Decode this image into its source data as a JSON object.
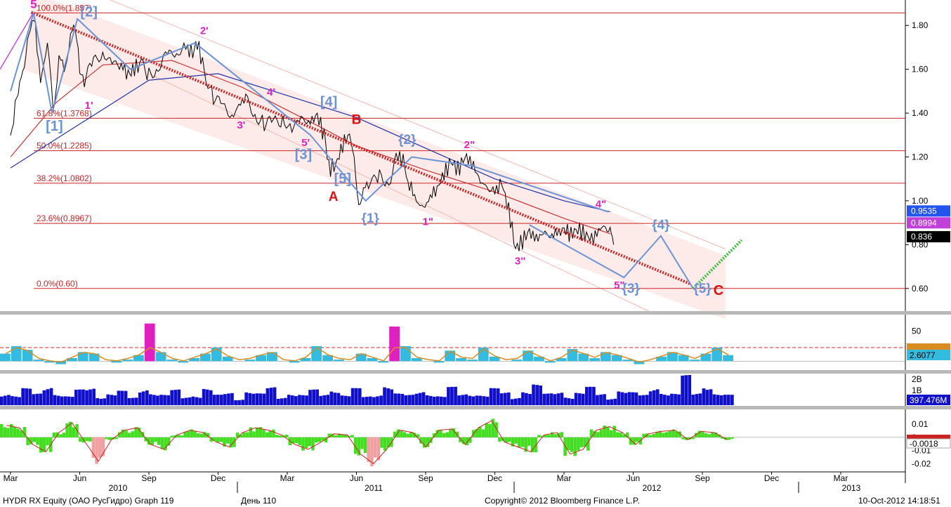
{
  "colors": {
    "price": "#000000",
    "fib": "#cc2222",
    "trend": "#cc2222",
    "wave_blue": "#6b93d6",
    "wave_magenta": "#e020c0",
    "wave_red": "#dd1111",
    "ma_blue": "#2233aa",
    "ma_red": "#cc3333",
    "volume": "#1010cc",
    "osc_cyan": "#33bbe0",
    "osc_orange": "#d98c20",
    "macd_green": "#44dd22",
    "macd_red": "#cc2222",
    "grid": "#999999"
  },
  "chart_data": [
    {
      "type": "line",
      "panel": "price",
      "ylim": [
        0.5,
        1.9
      ],
      "yticks": [
        "1.80",
        "1.60",
        "1.40",
        "1.20",
        "1.00",
        "0.80",
        "0.60"
      ],
      "x_months": [
        "Mar",
        "Jun",
        "Sep",
        "Dec",
        "Mar",
        "Jun",
        "Sep",
        "Dec",
        "Mar",
        "Jun",
        "Sep",
        "Dec",
        "Mar"
      ],
      "x_years": [
        "2010",
        "2011",
        "2012",
        "2013"
      ],
      "fib_levels": [
        {
          "label": "100.0%(1.857)",
          "value": 1.857
        },
        {
          "label": "61.8%(1.3768)",
          "value": 1.3768
        },
        {
          "label": "50.0%(1.2285)",
          "value": 1.2285
        },
        {
          "label": "38.2%(1.0802)",
          "value": 1.0802
        },
        {
          "label": "23.6%(0.8967)",
          "value": 0.8967
        },
        {
          "label": "0.0%(0.60)",
          "value": 0.6
        }
      ],
      "price_tags": [
        {
          "value": 0.9535,
          "label": "0.9535",
          "bg": "#2255ee",
          "fg": "#ffffff"
        },
        {
          "value": 0.8994,
          "label": "0.8994",
          "bg": "#c040d8",
          "fg": "#ffffff"
        },
        {
          "value": 0.836,
          "label": "0.836",
          "bg": "#000000",
          "fg": "#ffffff"
        }
      ],
      "price_series": [
        [
          0,
          1.28
        ],
        [
          0.2,
          1.42
        ],
        [
          0.4,
          1.52
        ],
        [
          0.6,
          1.62
        ],
        [
          0.8,
          1.8
        ],
        [
          1.0,
          1.857
        ],
        [
          1.3,
          1.55
        ],
        [
          1.6,
          1.7
        ],
        [
          1.85,
          1.42
        ],
        [
          2.1,
          1.66
        ],
        [
          2.4,
          1.6
        ],
        [
          2.6,
          1.75
        ],
        [
          2.8,
          1.8
        ],
        [
          3.0,
          1.62
        ],
        [
          3.2,
          1.55
        ],
        [
          3.6,
          1.62
        ],
        [
          4.0,
          1.67
        ],
        [
          4.4,
          1.64
        ],
        [
          4.8,
          1.62
        ],
        [
          5.1,
          1.58
        ],
        [
          5.3,
          1.6
        ],
        [
          5.6,
          1.62
        ],
        [
          6.0,
          1.57
        ],
        [
          6.4,
          1.62
        ],
        [
          6.8,
          1.68
        ],
        [
          7.2,
          1.66
        ],
        [
          7.6,
          1.7
        ],
        [
          7.9,
          1.67
        ],
        [
          8.1,
          1.72
        ],
        [
          8.4,
          1.6
        ],
        [
          8.8,
          1.48
        ],
        [
          9.2,
          1.42
        ],
        [
          9.6,
          1.38
        ],
        [
          9.9,
          1.43
        ],
        [
          10.2,
          1.48
        ],
        [
          10.6,
          1.4
        ],
        [
          11.0,
          1.35
        ],
        [
          11.4,
          1.34
        ],
        [
          11.8,
          1.37
        ],
        [
          12.2,
          1.34
        ],
        [
          12.6,
          1.38
        ],
        [
          13.0,
          1.36
        ],
        [
          13.3,
          1.39
        ],
        [
          13.6,
          1.3
        ],
        [
          13.8,
          1.15
        ],
        [
          14.1,
          1.16
        ],
        [
          14.4,
          1.26
        ],
        [
          14.7,
          1.3
        ],
        [
          14.9,
          1.22
        ],
        [
          15.1,
          1.0
        ],
        [
          15.3,
          1.06
        ],
        [
          15.6,
          1.08
        ],
        [
          16.0,
          1.12
        ],
        [
          16.4,
          1.1
        ],
        [
          16.8,
          1.2
        ],
        [
          17.1,
          1.18
        ],
        [
          17.3,
          1.08
        ],
        [
          17.6,
          1.0
        ],
        [
          17.9,
          0.96
        ],
        [
          18.2,
          1.02
        ],
        [
          18.5,
          1.06
        ],
        [
          18.8,
          1.12
        ],
        [
          19.1,
          1.18
        ],
        [
          19.4,
          1.14
        ],
        [
          19.7,
          1.2
        ],
        [
          20.0,
          1.18
        ],
        [
          20.3,
          1.1
        ],
        [
          20.6,
          1.06
        ],
        [
          21.0,
          1.04
        ],
        [
          21.3,
          1.08
        ],
        [
          21.6,
          0.96
        ],
        [
          21.9,
          0.78
        ],
        [
          22.2,
          0.82
        ],
        [
          22.5,
          0.86
        ],
        [
          22.8,
          0.82
        ],
        [
          23.1,
          0.86
        ],
        [
          23.4,
          0.84
        ],
        [
          23.7,
          0.85
        ],
        [
          24.0,
          0.87
        ],
        [
          24.3,
          0.85
        ],
        [
          24.6,
          0.87
        ],
        [
          24.9,
          0.85
        ],
        [
          25.2,
          0.82
        ],
        [
          25.5,
          0.86
        ],
        [
          25.8,
          0.9
        ],
        [
          26.0,
          0.88
        ],
        [
          26.15,
          0.8
        ]
      ],
      "trend_line": [
        [
          0.9,
          1.86
        ],
        [
          29.5,
          0.62
        ]
      ],
      "wave_path": [
        [
          0,
          1.5
        ],
        [
          1.0,
          1.857
        ],
        [
          1.8,
          1.4
        ],
        [
          2.9,
          1.83
        ],
        [
          5.2,
          1.6
        ],
        [
          8.0,
          1.72
        ],
        [
          13.0,
          1.3
        ],
        [
          15.4,
          1.0
        ],
        [
          17.4,
          1.2
        ],
        [
          20.0,
          1.16
        ],
        [
          25.9,
          0.95
        ]
      ],
      "forecast_path": [
        [
          22.5,
          0.89
        ],
        [
          26.6,
          0.65
        ],
        [
          28.2,
          0.84
        ],
        [
          29.6,
          0.6
        ]
      ],
      "wave_labels": [
        {
          "text": "5",
          "x": 1.0,
          "y": 1.88,
          "color": "wave_magenta",
          "size": 17
        },
        {
          "text": "[2]",
          "x": 3.4,
          "y": 1.84,
          "color": "wave_blue",
          "size": 20
        },
        {
          "text": "[1]",
          "x": 1.9,
          "y": 1.32,
          "color": "wave_blue",
          "size": 20
        },
        {
          "text": "1'",
          "x": 3.4,
          "y": 1.42,
          "color": "wave_magenta",
          "size": 15
        },
        {
          "text": "2'",
          "x": 8.4,
          "y": 1.76,
          "color": "wave_magenta",
          "size": 15
        },
        {
          "text": "3'",
          "x": 10.0,
          "y": 1.33,
          "color": "wave_magenta",
          "size": 15
        },
        {
          "text": "4'",
          "x": 11.3,
          "y": 1.48,
          "color": "wave_magenta",
          "size": 15
        },
        {
          "text": "[4]",
          "x": 13.8,
          "y": 1.43,
          "color": "wave_blue",
          "size": 20
        },
        {
          "text": "5'",
          "x": 12.8,
          "y": 1.25,
          "color": "wave_magenta",
          "size": 15
        },
        {
          "text": "[3]",
          "x": 12.7,
          "y": 1.19,
          "color": "wave_blue",
          "size": 20
        },
        {
          "text": "B",
          "x": 15.0,
          "y": 1.35,
          "color": "wave_red",
          "size": 19
        },
        {
          "text": "[5]",
          "x": 14.4,
          "y": 1.08,
          "color": "wave_blue",
          "size": 20
        },
        {
          "text": "A",
          "x": 14.0,
          "y": 1.0,
          "color": "wave_red",
          "size": 19
        },
        {
          "text": "{1}",
          "x": 15.6,
          "y": 0.9,
          "color": "wave_blue",
          "size": 19
        },
        {
          "text": "{2}",
          "x": 17.2,
          "y": 1.26,
          "color": "wave_blue",
          "size": 19
        },
        {
          "text": "1\"",
          "x": 18.1,
          "y": 0.89,
          "color": "wave_magenta",
          "size": 15
        },
        {
          "text": "2\"",
          "x": 19.9,
          "y": 1.24,
          "color": "wave_magenta",
          "size": 15
        },
        {
          "text": "3\"",
          "x": 22.1,
          "y": 0.71,
          "color": "wave_magenta",
          "size": 15
        },
        {
          "text": "4\"",
          "x": 25.6,
          "y": 0.97,
          "color": "wave_magenta",
          "size": 15
        },
        {
          "text": "{4}",
          "x": 28.2,
          "y": 0.87,
          "color": "wave_blue",
          "size": 19
        },
        {
          "text": "5\"",
          "x": 26.4,
          "y": 0.6,
          "color": "wave_magenta",
          "size": 15
        },
        {
          "text": "{3}",
          "x": 26.9,
          "y": 0.58,
          "color": "wave_blue",
          "size": 19
        },
        {
          "text": "{5}",
          "x": 30.0,
          "y": 0.58,
          "color": "wave_blue",
          "size": 19
        },
        {
          "text": "C",
          "x": 30.7,
          "y": 0.57,
          "color": "wave_red",
          "size": 20
        }
      ]
    },
    {
      "type": "area",
      "panel": "oscillator",
      "ylim": [
        0,
        70
      ],
      "yticks": [
        "50"
      ],
      "last_value": "2.6077",
      "series": [
        {
          "values": [
            20,
            30,
            25,
            12,
            8,
            6,
            14,
            22,
            20,
            10,
            8,
            12,
            18,
            60,
            22,
            12,
            8,
            14,
            20,
            28,
            16,
            10,
            12,
            18,
            22,
            10,
            8,
            14,
            30,
            18,
            12,
            10,
            20,
            14,
            8,
            56,
            30,
            14,
            10,
            8,
            24,
            14,
            12,
            28,
            16,
            10,
            12,
            24,
            16,
            8,
            14,
            26,
            20,
            14,
            22,
            18,
            12,
            6,
            10,
            16,
            22,
            18,
            12,
            20,
            28,
            18
          ]
        }
      ]
    },
    {
      "type": "bar",
      "panel": "volume",
      "ylim": [
        0,
        2.3
      ],
      "yticks": [
        "2B",
        "1B"
      ],
      "last_value": "397.476M",
      "series": [
        {
          "values": [
            1.1,
            0.8,
            1.3,
            0.9,
            1.6,
            1.0,
            0.7,
            1.2,
            1.4,
            0.8,
            0.9,
            1.1,
            0.6,
            1.5,
            1.0,
            0.8,
            1.2,
            0.7,
            0.9,
            1.3,
            0.8,
            1.0,
            0.6,
            1.1,
            0.9,
            1.4,
            0.7,
            1.0,
            0.8,
            1.2,
            0.9,
            1.5,
            0.8,
            1.3,
            0.7,
            1.0,
            1.6,
            0.9,
            0.8,
            1.2,
            1.0,
            0.7,
            1.4,
            0.9,
            1.1,
            0.8,
            1.3,
            1.0,
            0.7,
            1.2,
            1.6,
            0.9,
            1.1,
            0.8,
            1.0,
            1.4,
            0.9,
            0.7,
            1.2,
            1.0,
            0.8,
            1.5,
            1.1,
            0.9,
            2.3,
            1.0,
            1.9,
            0.9,
            0.8
          ]
        }
      ]
    },
    {
      "type": "area",
      "panel": "macd",
      "ylim": [
        -0.026,
        0.02
      ],
      "yticks": [
        "0.01",
        "0",
        "-0.01",
        "-0.02"
      ],
      "last_value": "-0.0018",
      "series": [
        {
          "values": [
            0.01,
            0.008,
            -0.006,
            -0.012,
            0.004,
            0.012,
            -0.004,
            -0.02,
            -0.002,
            0.006,
            0.008,
            -0.006,
            -0.01,
            0.002,
            0.006,
            0.004,
            -0.004,
            -0.008,
            0.004,
            0.008,
            0.006,
            0.002,
            -0.006,
            -0.01,
            -0.004,
            0.003,
            0.002,
            -0.014,
            -0.022,
            -0.01,
            0.006,
            0.004,
            -0.008,
            0.006,
            0.007,
            -0.006,
            0.008,
            0.014,
            -0.004,
            -0.008,
            -0.012,
            0.002,
            0.004,
            -0.014,
            -0.01,
            0.006,
            0.009,
            0.004,
            -0.006,
            0.003,
            0.005,
            0.006,
            -0.002,
            0.005,
            0.004,
            -0.002
          ]
        }
      ]
    }
  ],
  "footer": {
    "left": "HYDR RX Equity (ОАО РусГидро) Graph 119",
    "mid": "День 110",
    "copyright": "Copyright© 2012 Bloomberg Finance L.P.",
    "date": "10-Oct-2012 14:18:51"
  }
}
